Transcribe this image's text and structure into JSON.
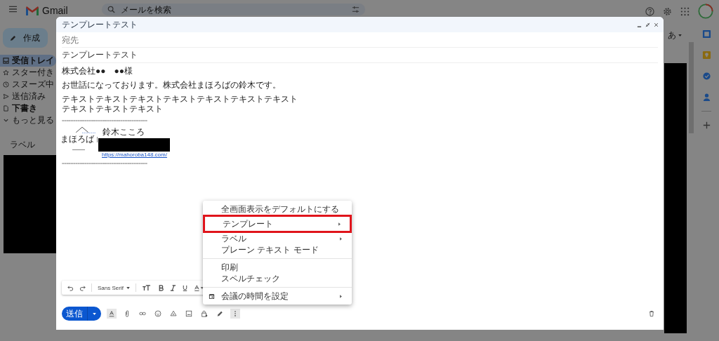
{
  "topbar": {
    "app_name": "Gmail",
    "search": {
      "placeholder": "メールを検索"
    }
  },
  "sidebar": {
    "compose": "作成",
    "items": [
      {
        "label": "受信トレイ",
        "selected": true,
        "bold": true,
        "kind": "inbox"
      },
      {
        "label": "スター付き",
        "selected": false,
        "bold": false,
        "kind": "star"
      },
      {
        "label": "スヌーズ中",
        "selected": false,
        "bold": false,
        "kind": "clock"
      },
      {
        "label": "送信済み",
        "selected": false,
        "bold": false,
        "kind": "send"
      },
      {
        "label": "下書き",
        "selected": false,
        "bold": true,
        "kind": "draft"
      },
      {
        "label": "もっと見る",
        "selected": false,
        "bold": false,
        "kind": "more"
      }
    ],
    "labels_heading": "ラベル"
  },
  "input_mode": "あ",
  "compose": {
    "title": "テンプレートテスト",
    "to_placeholder": "宛先",
    "subject": "テンプレートテスト",
    "paragraphs": [
      [
        "株式会社●●　●●様"
      ],
      [
        "お世話になっております。株式会社まほろばの鈴木です。"
      ],
      [
        "テキストテキストテキストテキストテキストテキストテキスト",
        "テキストテキストテキスト"
      ]
    ],
    "signature": {
      "rule": "======================================",
      "logo_text": "まほろば",
      "name": "鈴木こころ",
      "link": "https://mahoroba148.com/"
    },
    "font": "Sans Serif",
    "send": "送信"
  },
  "menu": {
    "groups": [
      [
        {
          "label": "全画面表示をデフォルトにする",
          "submenu": false,
          "highlighted": false,
          "kind": "plain"
        },
        {
          "label": "テンプレート",
          "submenu": true,
          "highlighted": true,
          "kind": "plain"
        },
        {
          "label": "ラベル",
          "submenu": true,
          "highlighted": false,
          "kind": "plain"
        },
        {
          "label": "プレーン テキスト モード",
          "submenu": false,
          "highlighted": false,
          "kind": "plain"
        }
      ],
      [
        {
          "label": "印刷",
          "submenu": false,
          "highlighted": false,
          "kind": "plain"
        },
        {
          "label": "スペルチェック",
          "submenu": false,
          "highlighted": false,
          "kind": "plain"
        }
      ],
      [
        {
          "label": "会議の時間を設定",
          "submenu": true,
          "highlighted": false,
          "kind": "calendar"
        }
      ]
    ]
  }
}
